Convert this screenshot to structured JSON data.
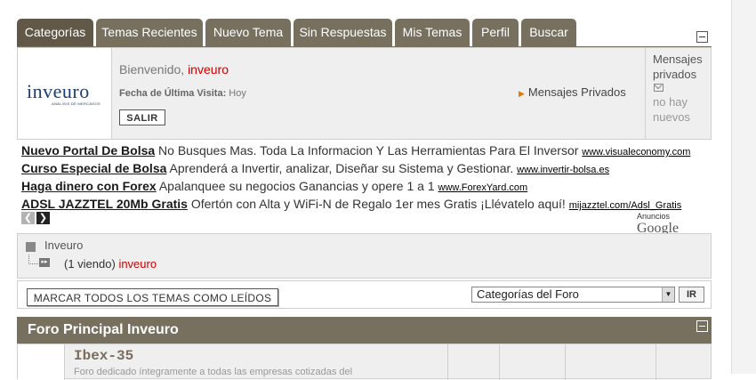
{
  "tabs": [
    {
      "label": "Categorías",
      "active": true
    },
    {
      "label": "Temas Recientes"
    },
    {
      "label": "Nuevo Tema"
    },
    {
      "label": "Sin Respuestas"
    },
    {
      "label": "Mis Temas"
    },
    {
      "label": "Perfil"
    },
    {
      "label": "Buscar"
    }
  ],
  "logo": {
    "name": "inveuro",
    "tagline": "ANÁLISIS DE MERCADOS"
  },
  "welcome": {
    "greeting": "Bienvenido,",
    "username": "inveuro",
    "last_visit_label": "Fecha de Última Visita:",
    "last_visit_value": "Hoy",
    "logout_label": "SALIR",
    "pm_link": "Mensajes Privados"
  },
  "pm_panel": {
    "title": "Mensajes privados",
    "status": "no hay nuevos"
  },
  "ads": [
    {
      "headline": "Nuevo Portal De Bolsa",
      "text": "No Busques Mas. Toda La Informacion Y Las Herramientas Para El Inversor",
      "url": "www.visualeconomy.com"
    },
    {
      "headline": "Curso Especial de Bolsa",
      "text": "Aprenderá a Invertir, analizar, Diseñar su Sistema y Gestionar.",
      "url": "www.invertir-bolsa.es"
    },
    {
      "headline": "Haga dinero con Forex",
      "text": "Apalanquee su negocios Ganancias y opere 1 a 1",
      "url": "www.ForexYard.com"
    },
    {
      "headline": "ADSL JAZZTEL 20Mb Gratis",
      "text": "Ofertón con Alta y WiFi-N de Regalo 1er mes Gratis ¡Llévatelo aquí!",
      "url": "mijazztel.com/Adsl_Gratis"
    }
  ],
  "ads_by": {
    "label": "Anuncios",
    "brand": "Google"
  },
  "online": {
    "title": "Inveuro",
    "count": "(1 viendo)",
    "user": "inveuro"
  },
  "actions": {
    "mark_all_read": "MARCAR TODOS LOS TEMAS COMO LEÍDOS",
    "forum_select": "Categorías del Foro",
    "go": "IR"
  },
  "forum": {
    "category": "Foro Principal Inveuro",
    "rows": [
      {
        "title": "Ibex-35",
        "description": "Foro dedicado íntegramente a todas las empresas cotizadas del"
      }
    ]
  },
  "colors": {
    "tab_bg": "#77705f",
    "tab_active": "#615848",
    "accent_red": "#cc0000"
  }
}
